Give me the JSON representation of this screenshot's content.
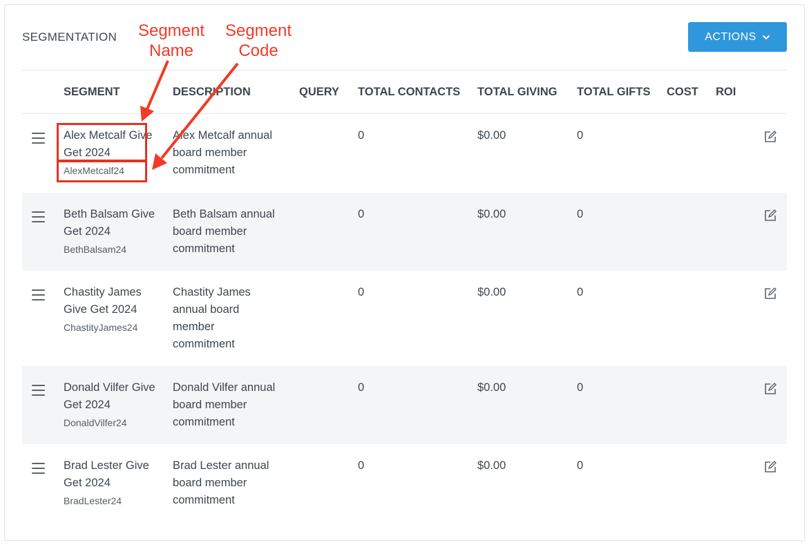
{
  "header": {
    "title": "SEGMENTATION",
    "actions_label": "ACTIONS"
  },
  "columns": [
    "SEGMENT",
    "DESCRIPTION",
    "QUERY",
    "TOTAL CONTACTS",
    "TOTAL GIVING",
    "TOTAL GIFTS",
    "COST",
    "ROI"
  ],
  "rows": [
    {
      "name": "Alex Metcalf Give Get 2024",
      "code": "AlexMetcalf24",
      "description": "Alex Metcalf annual board member commitment",
      "query": "",
      "total_contacts": "0",
      "total_giving": "$0.00",
      "total_gifts": "0",
      "cost": "",
      "roi": ""
    },
    {
      "name": "Beth Balsam Give Get 2024",
      "code": "BethBalsam24",
      "description": "Beth Balsam annual board member commitment",
      "query": "",
      "total_contacts": "0",
      "total_giving": "$0.00",
      "total_gifts": "0",
      "cost": "",
      "roi": ""
    },
    {
      "name": "Chastity James Give Get 2024",
      "code": "ChastityJames24",
      "description": "Chastity James annual board member commitment",
      "query": "",
      "total_contacts": "0",
      "total_giving": "$0.00",
      "total_gifts": "0",
      "cost": "",
      "roi": ""
    },
    {
      "name": "Donald Vilfer Give Get 2024",
      "code": "DonaldVilfer24",
      "description": "Donald Vilfer annual board member commitment",
      "query": "",
      "total_contacts": "0",
      "total_giving": "$0.00",
      "total_gifts": "0",
      "cost": "",
      "roi": ""
    },
    {
      "name": "Brad Lester Give Get 2024",
      "code": "BradLester24",
      "description": "Brad Lester annual board member commitment",
      "query": "",
      "total_contacts": "0",
      "total_giving": "$0.00",
      "total_gifts": "0",
      "cost": "",
      "roi": ""
    }
  ],
  "annotations": {
    "segment_name": "Segment Name",
    "segment_code": "Segment Code",
    "color": "#f23a26"
  },
  "colors": {
    "accent": "#2f97dc",
    "row_shade": "#f4f5f6"
  },
  "icons": {
    "drag": "drag-handle-icon",
    "edit": "edit-icon",
    "dropdown": "chevron-down-icon"
  }
}
